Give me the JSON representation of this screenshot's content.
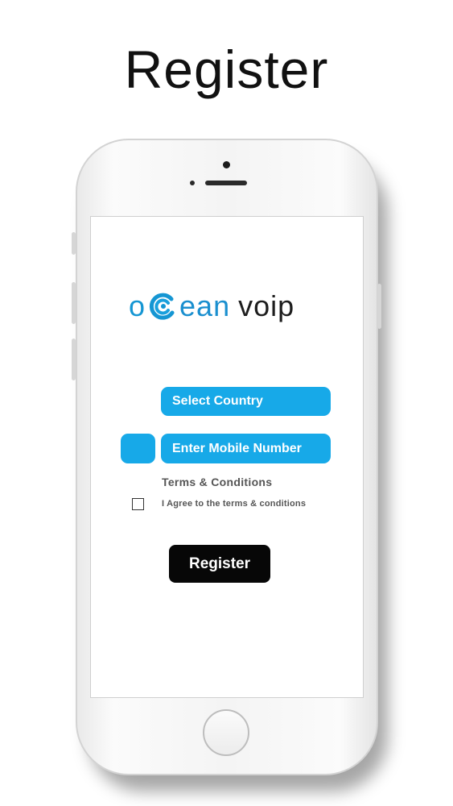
{
  "page": {
    "headline": "Register"
  },
  "logo": {
    "part1": "o",
    "wave_icon": "wave-icon",
    "part2": "ean",
    "part3": "voip"
  },
  "form": {
    "country_label": "Select Country",
    "country_code_value": "",
    "mobile_placeholder": "Enter Mobile Number",
    "terms_title": "Terms & Conditions",
    "agree_label": "I Agree to the terms & conditions",
    "agree_checked": false,
    "submit_label": "Register"
  },
  "colors": {
    "accent": "#17a9e8",
    "logo_blue": "#1596d3",
    "button_dark": "#070707",
    "text_gray": "#555555"
  }
}
